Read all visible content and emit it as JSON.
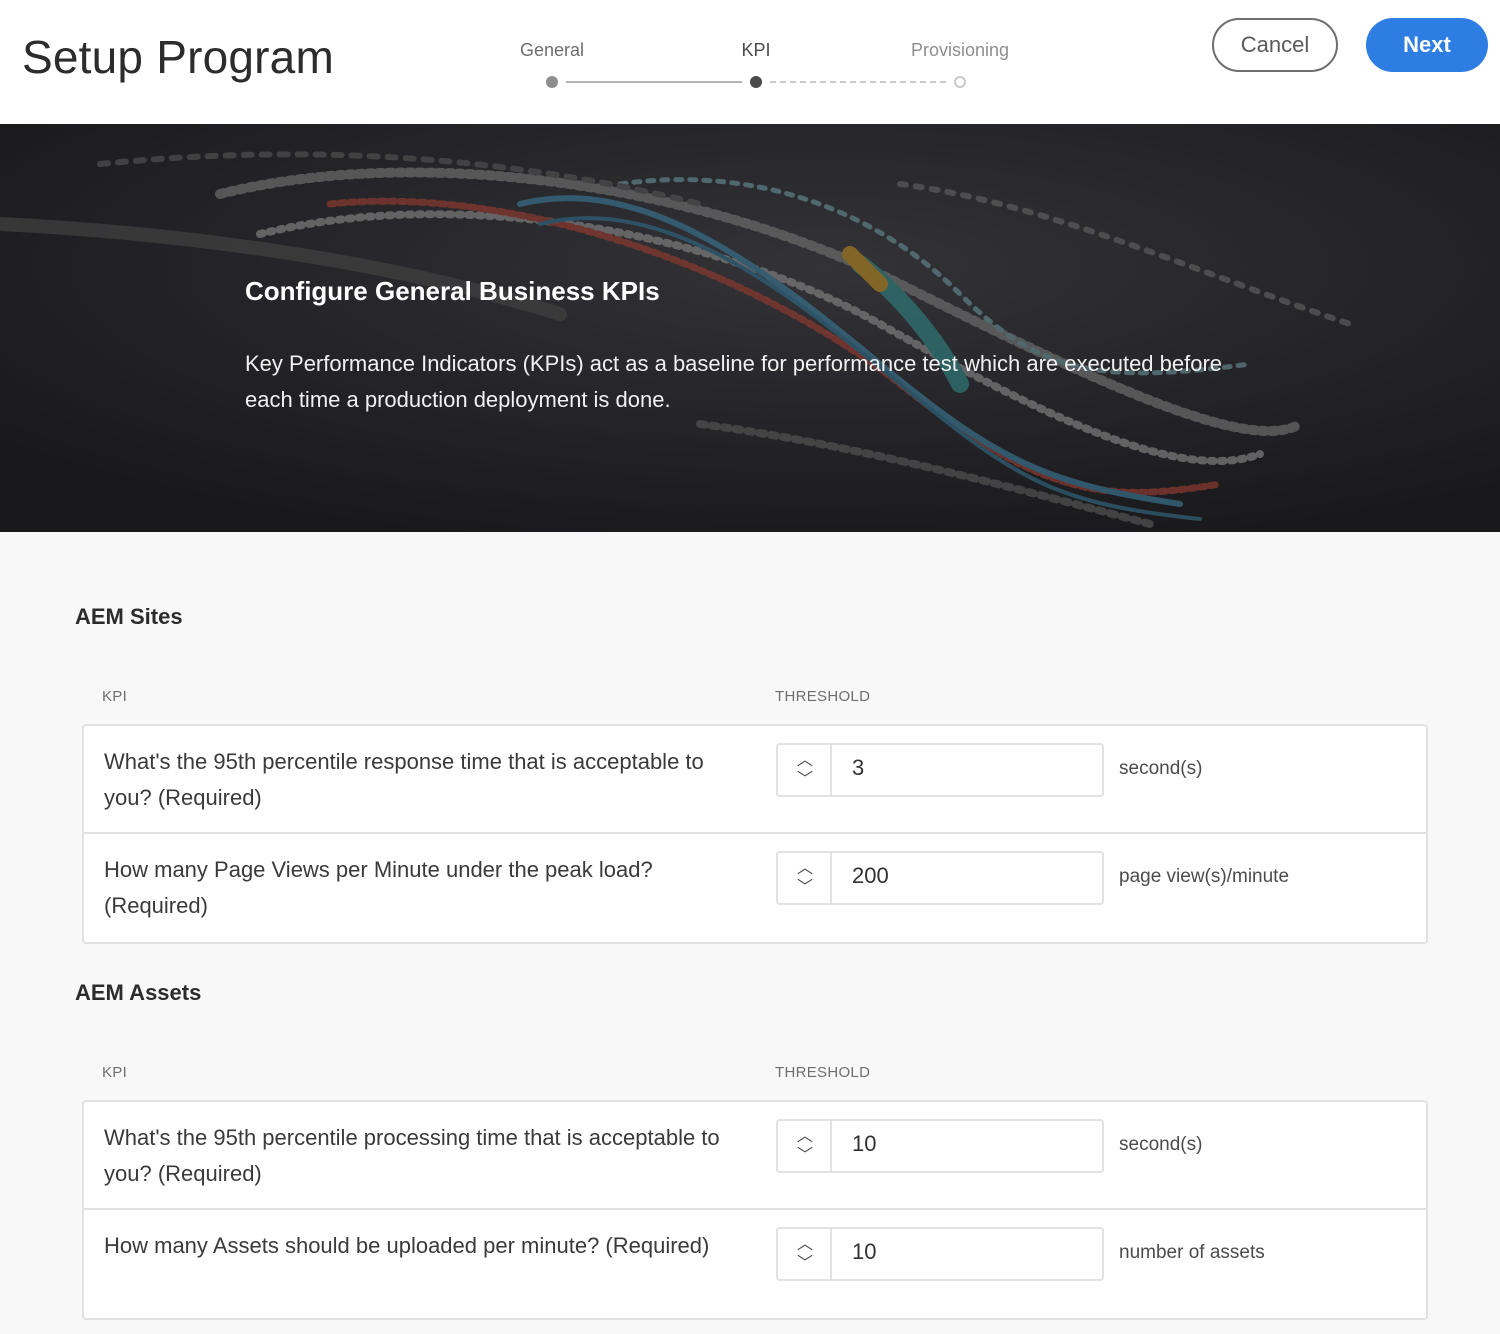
{
  "header": {
    "title": "Setup Program",
    "steps": [
      {
        "label": "General",
        "state": "done"
      },
      {
        "label": "KPI",
        "state": "current"
      },
      {
        "label": "Provisioning",
        "state": "todo"
      }
    ],
    "cancel_label": "Cancel",
    "next_label": "Next"
  },
  "hero": {
    "title": "Configure General Business KPIs",
    "description": "Key Performance Indicators (KPIs) act as a baseline for performance test which are executed before each time a production deployment is done."
  },
  "sections": [
    {
      "title": "AEM Sites",
      "kpi_header": "KPI",
      "threshold_header": "THRESHOLD",
      "rows": [
        {
          "question": "What's the 95th percentile response time that is acceptable to you? (Required)",
          "value": "3",
          "unit": "second(s)"
        },
        {
          "question": "How many Page Views per Minute under the peak load? (Required)",
          "value": "200",
          "unit": "page view(s)/minute"
        }
      ]
    },
    {
      "title": "AEM Assets",
      "kpi_header": "KPI",
      "threshold_header": "THRESHOLD",
      "rows": [
        {
          "question": "What's the 95th percentile processing time that is acceptable to you? (Required)",
          "value": "10",
          "unit": "second(s)"
        },
        {
          "question": "How many Assets should be uploaded per minute? (Required)",
          "value": "10",
          "unit": "number of assets"
        }
      ]
    }
  ],
  "icons": {
    "increment": "chevron-up-icon",
    "decrement": "chevron-down-icon"
  },
  "colors": {
    "accent": "#2d7de3",
    "hero_bg": "#2b2b2f"
  }
}
